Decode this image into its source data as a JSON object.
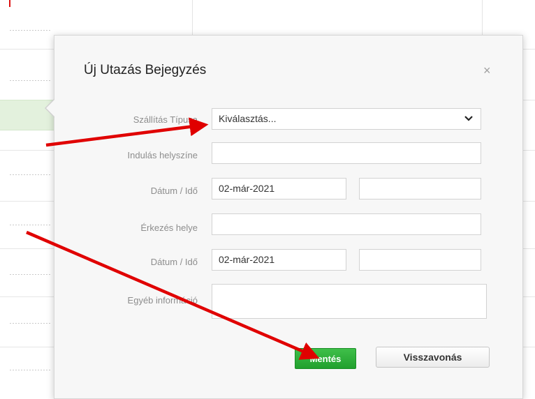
{
  "dialog": {
    "title": "Új Utazás Bejegyzés",
    "close_symbol": "×"
  },
  "form": {
    "transport_type": {
      "label": "Szállítás Típusa",
      "value": "Kiválasztás..."
    },
    "departure_place": {
      "label": "Indulás helyszíne",
      "value": ""
    },
    "departure_datetime": {
      "label": "Dátum / Idő",
      "date": "02-már-2021",
      "time": ""
    },
    "arrival_place": {
      "label": "Érkezés helye",
      "value": ""
    },
    "arrival_datetime": {
      "label": "Dátum / Idő",
      "date": "02-már-2021",
      "time": ""
    },
    "other_info": {
      "label": "Egyéb információ",
      "value": ""
    }
  },
  "buttons": {
    "save_label": "Mentés",
    "cancel_label": "Visszavonás"
  },
  "colors": {
    "save_button": "#21a02d",
    "annotation_arrows": "#e00000"
  },
  "icons": {
    "close": "close-icon",
    "dropdown": "chevron-down-icon"
  }
}
